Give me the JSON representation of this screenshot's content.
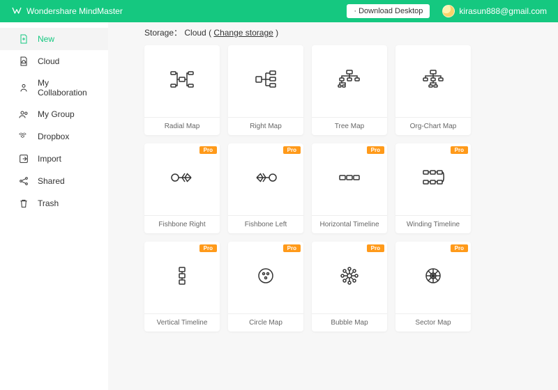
{
  "app": {
    "name": "Wondershare MindMaster"
  },
  "header": {
    "download_label": "· Download Desktop",
    "user_email": "kirasun888@gmail.com"
  },
  "sidebar": {
    "items": [
      {
        "label": "New",
        "icon": "new-file-icon",
        "active": true
      },
      {
        "label": "Cloud",
        "icon": "cloud-icon"
      },
      {
        "label": "My Collaboration",
        "icon": "collab-icon"
      },
      {
        "label": "My Group",
        "icon": "group-icon"
      },
      {
        "label": "Dropbox",
        "icon": "dropbox-icon"
      },
      {
        "label": "Import",
        "icon": "import-icon"
      },
      {
        "label": "Shared",
        "icon": "share-icon"
      },
      {
        "label": "Trash",
        "icon": "trash-icon"
      }
    ]
  },
  "storage": {
    "prefix": "Storage：",
    "location": "Cloud",
    "change_label": "Change storage"
  },
  "pro_badge": "Pro",
  "templates": [
    {
      "label": "Radial Map",
      "icon": "radial-map-icon",
      "pro": false
    },
    {
      "label": "Right Map",
      "icon": "right-map-icon",
      "pro": false
    },
    {
      "label": "Tree Map",
      "icon": "tree-map-icon",
      "pro": false
    },
    {
      "label": "Org-Chart Map",
      "icon": "org-chart-icon",
      "pro": false
    },
    {
      "label": "Fishbone Right",
      "icon": "fishbone-right-icon",
      "pro": true
    },
    {
      "label": "Fishbone Left",
      "icon": "fishbone-left-icon",
      "pro": true
    },
    {
      "label": "Horizontal Timeline",
      "icon": "horizontal-timeline-icon",
      "pro": true
    },
    {
      "label": "Winding Timeline",
      "icon": "winding-timeline-icon",
      "pro": true
    },
    {
      "label": "Vertical Timeline",
      "icon": "vertical-timeline-icon",
      "pro": true
    },
    {
      "label": "Circle Map",
      "icon": "circle-map-icon",
      "pro": true
    },
    {
      "label": "Bubble Map",
      "icon": "bubble-map-icon",
      "pro": true
    },
    {
      "label": "Sector Map",
      "icon": "sector-map-icon",
      "pro": true
    }
  ],
  "colors": {
    "accent": "#15c880",
    "pro_badge": "#ff9a1a"
  }
}
